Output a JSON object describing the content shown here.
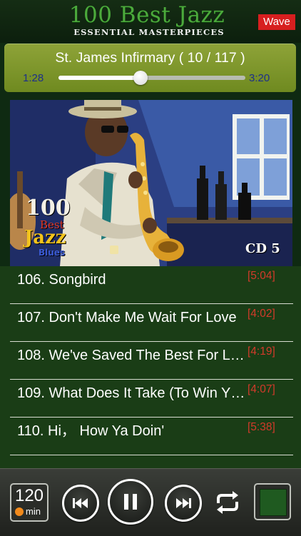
{
  "header": {
    "title": "100 Best Jazz",
    "subtitle": "ESSENTIAL MASTERPIECES",
    "wave_label": "Wave"
  },
  "now_playing": {
    "title": "St. James Infirmary ( 10 / 117 )",
    "elapsed": "1:28",
    "total": "3:20",
    "progress": 0.44
  },
  "album": {
    "logo_number": "100",
    "logo_best": "Best",
    "logo_jazz": "Jazz",
    "logo_blues": "Blues",
    "cd_label": "CD 5"
  },
  "tracks": [
    {
      "title": "106. Songbird",
      "duration": "[5:04]"
    },
    {
      "title": "107. Don't Make Me Wait For Love",
      "duration": "[4:02]"
    },
    {
      "title": "108. We've Saved The Best For L…",
      "duration": "[4:19]"
    },
    {
      "title": "109. What Does It Take (To Win Y…",
      "duration": "[4:07]"
    },
    {
      "title": "110. Hi， How Ya Doin'",
      "duration": "[5:38]"
    }
  ],
  "controls": {
    "timer_value": "120",
    "timer_unit": "min"
  }
}
